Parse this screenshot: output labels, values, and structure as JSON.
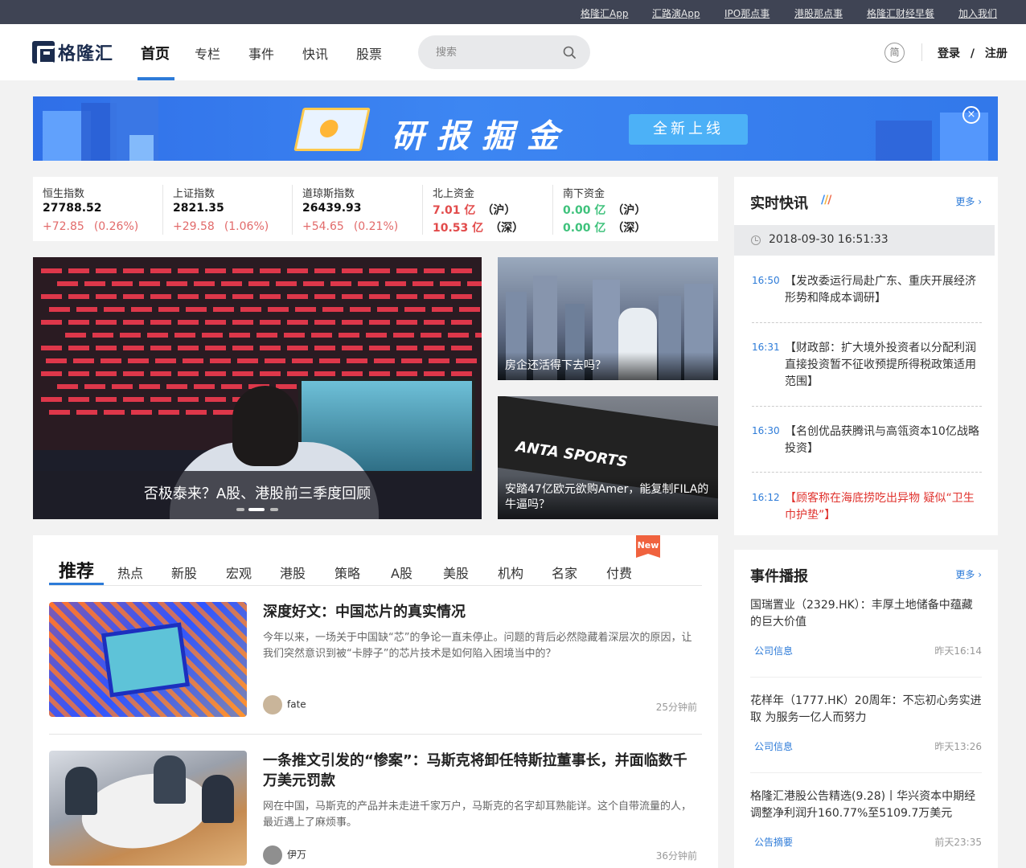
{
  "topbar": {
    "links": [
      "格隆汇App",
      "汇路演App",
      "IPO那点事",
      "港股那点事",
      "格隆汇财经早餐",
      "加入我们"
    ]
  },
  "header": {
    "logo_text": "格隆汇",
    "nav": [
      "首页",
      "专栏",
      "事件",
      "快讯",
      "股票"
    ],
    "active_nav": "首页",
    "search_placeholder": "搜索",
    "lang_label": "简",
    "login_label": "登录",
    "login_sep": "/",
    "register_label": "注册"
  },
  "banner": {
    "title": "研报掘金",
    "button_label": "全新上线",
    "close_label": "×"
  },
  "indices": [
    {
      "name": "恒生指数",
      "value": "27788.52",
      "change": "+72.85",
      "percent": "(0.26%)"
    },
    {
      "name": "上证指数",
      "value": "2821.35",
      "change": "+29.58",
      "percent": "(1.06%)"
    },
    {
      "name": "道琼斯指数",
      "value": "26439.93",
      "change": "+54.65",
      "percent": "(0.21%)"
    }
  ],
  "north_flow": {
    "name": "北上资金",
    "rows": [
      {
        "amount": "7.01 亿",
        "market": "（沪）"
      },
      {
        "amount": "10.53 亿",
        "market": "（深）"
      }
    ]
  },
  "south_flow": {
    "name": "南下资金",
    "rows": [
      {
        "amount": "0.00 亿",
        "market": "（沪）"
      },
      {
        "amount": "0.00 亿",
        "market": "（深）"
      }
    ]
  },
  "hero": {
    "caption": "否极泰来？A股、港股前三季度回顾"
  },
  "side_cards": [
    {
      "caption": "房企还活得下去吗？"
    },
    {
      "caption": "安踏47亿欧元欲购Amer，能复制FILA的牛逼吗？",
      "sign_text": "ANTA SPORTS"
    }
  ],
  "recommend": {
    "tabs": [
      "推荐",
      "热点",
      "新股",
      "宏观",
      "港股",
      "策略",
      "A股",
      "美股",
      "机构",
      "名家",
      "付费"
    ],
    "new_badge": "New",
    "articles": [
      {
        "title": "深度好文：中国芯片的真实情况",
        "desc": "今年以来，一场关于中国缺“芯”的争论一直未停止。问题的背后必然隐藏着深层次的原因，让我们突然意识到被“卡脖子”的芯片技术是如何陷入困境当中的？",
        "author": "fate",
        "time": "25分钟前"
      },
      {
        "title": "一条推文引发的“惨案”：马斯克将卸任特斯拉董事长，并面临数千万美元罚款",
        "desc": "网在中国，马斯克的产品并未走进千家万户，马斯克的名字却耳熟能详。这个自带流量的人，最近遇上了麻烦事。",
        "author": "伊万",
        "time": "36分钟前"
      }
    ]
  },
  "live_news": {
    "title": "实时快讯",
    "more_label": "更多",
    "date": "2018-09-30 16:51:33",
    "items": [
      {
        "time": "16:50",
        "text": "【发改委运行局赴广东、重庆开展经济形势和降成本调研】",
        "hot": false
      },
      {
        "time": "16:31",
        "text": "【财政部：扩大境外投资者以分配利润直接投资暂不征收预提所得税政策适用范围】",
        "hot": false
      },
      {
        "time": "16:30",
        "text": "【名创优品获腾讯与高瓴资本10亿战略投资】",
        "hot": false
      },
      {
        "time": "16:12",
        "text": "【顾客称在海底捞吃出异物 疑似“卫生巾护垫”】",
        "hot": true
      }
    ]
  },
  "events": {
    "title": "事件播报",
    "more_label": "更多",
    "items": [
      {
        "title": "国瑞置业（2329.HK）：丰厚土地储备中蕴藏的巨大价值",
        "tag": "公司信息",
        "time": "昨天16:14"
      },
      {
        "title": "花样年（1777.HK）20周年：不忘初心务实进取 为服务一亿人而努力",
        "tag": "公司信息",
        "time": "昨天13:26"
      },
      {
        "title": "格隆汇港股公告精选(9.28)丨华兴资本中期经调整净利润升160.77%至5109.7万美元",
        "tag": "公告摘要",
        "time": "前天23:35"
      }
    ]
  },
  "colors": {
    "accent": "#2d7bd8",
    "topbar": "#3f4454",
    "up": "#e24b4b",
    "flat": "#3fc27c",
    "hot": "#e0332e"
  }
}
